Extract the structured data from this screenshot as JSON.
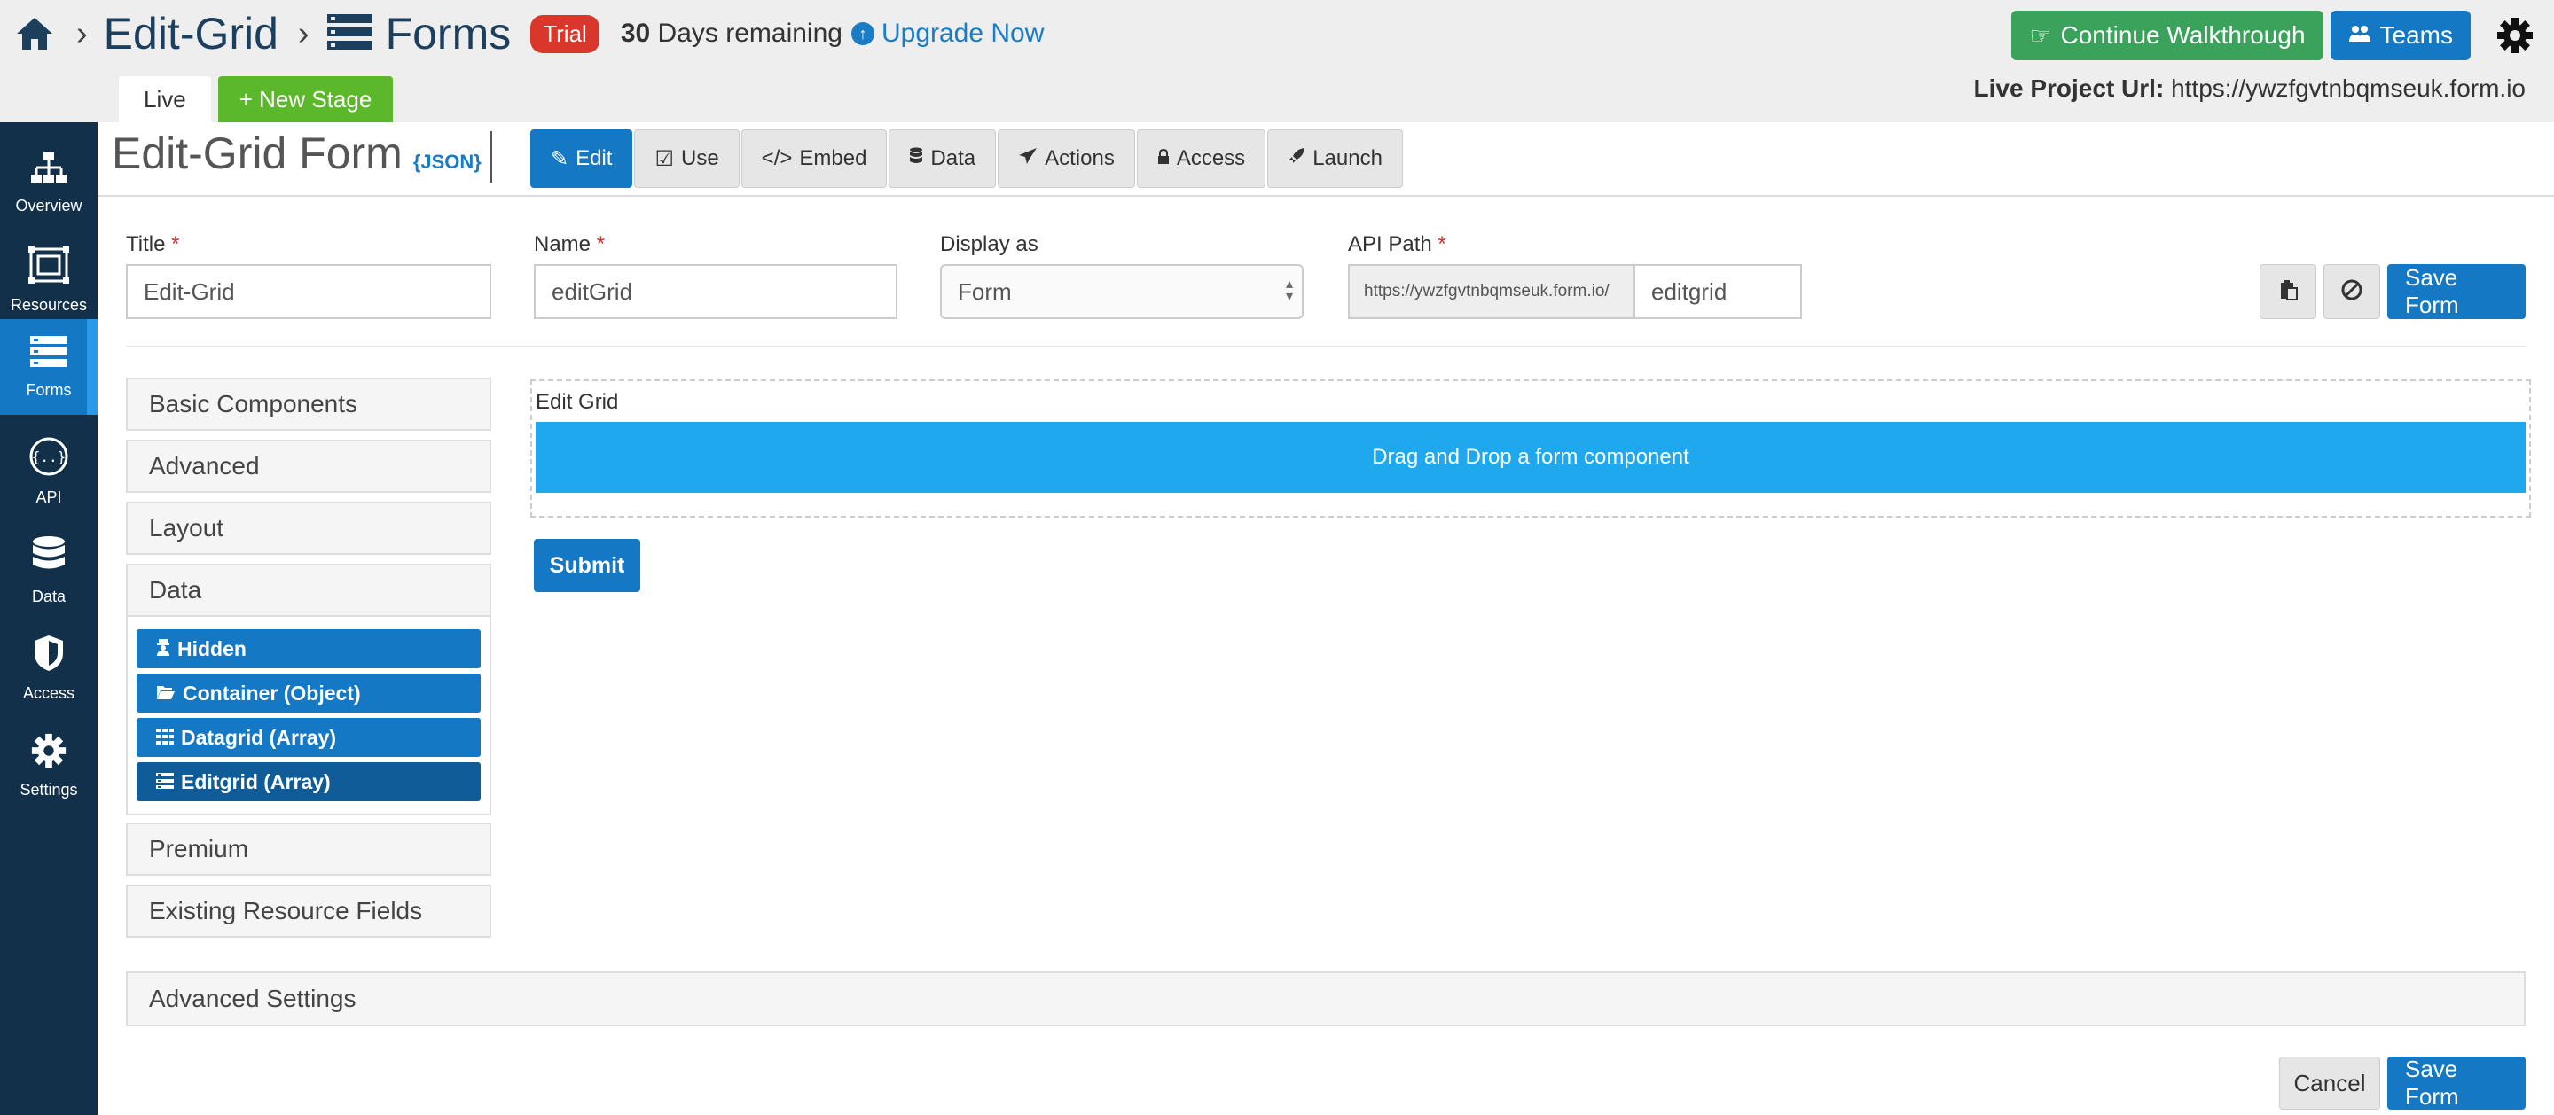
{
  "header": {
    "breadcrumb_project": "Edit-Grid",
    "breadcrumb_section": "Forms",
    "trial_badge": "Trial",
    "days_count": "30",
    "days_text": "Days remaining",
    "upgrade_label": "Upgrade Now",
    "walkthrough_label": "Continue Walkthrough",
    "teams_label": "Teams",
    "live_url_label": "Live Project Url:",
    "live_url_value": "https://ywzfgvtnbqmseuk.form.io"
  },
  "stages": {
    "live_label": "Live",
    "new_stage_label": "+ New Stage"
  },
  "sidebar": {
    "items": [
      {
        "label": "Overview",
        "icon": "sitemap-icon"
      },
      {
        "label": "Resources",
        "icon": "resources-icon"
      },
      {
        "label": "Forms",
        "icon": "forms-icon"
      },
      {
        "label": "API",
        "icon": "api-icon"
      },
      {
        "label": "Data",
        "icon": "database-icon"
      },
      {
        "label": "Access",
        "icon": "shield-icon"
      },
      {
        "label": "Settings",
        "icon": "gear-icon"
      }
    ]
  },
  "form": {
    "title": "Edit-Grid Form",
    "json_link": "{JSON}",
    "tabs": [
      "Edit",
      "Use",
      "Embed",
      "Data",
      "Actions",
      "Access",
      "Launch"
    ]
  },
  "fields": {
    "title_label": "Title",
    "title_value": "Edit-Grid",
    "name_label": "Name",
    "name_value": "editGrid",
    "display_label": "Display as",
    "display_value": "Form",
    "api_label": "API Path",
    "api_prefix": "https://ywzfgvtnbqmseuk.form.io/",
    "api_value": "editgrid",
    "required_mark": "*",
    "save_label": "Save Form"
  },
  "components": {
    "groups": [
      "Basic Components",
      "Advanced",
      "Layout",
      "Data",
      "Premium",
      "Existing Resource Fields"
    ],
    "data_items": [
      "Hidden",
      "Container (Object)",
      "Datagrid (Array)",
      "Editgrid (Array)"
    ]
  },
  "builder": {
    "edit_grid_label": "Edit Grid",
    "drop_text": "Drag and Drop a form component",
    "submit_label": "Submit"
  },
  "footer": {
    "advanced_settings": "Advanced Settings",
    "cancel_label": "Cancel",
    "save_label": "Save Form"
  },
  "colors": {
    "primary": "#1578c4",
    "sidebar": "#12304a",
    "success": "#3aa25a",
    "trial": "#d9372b",
    "dropzone": "#1fa8ee"
  }
}
